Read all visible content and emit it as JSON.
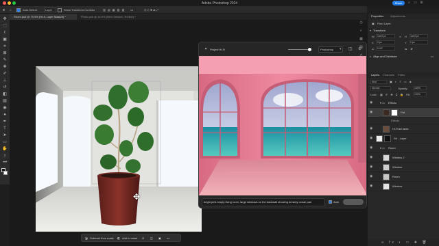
{
  "app": {
    "title": "Adobe Photoshop 2024",
    "share_label": "Share"
  },
  "options_bar": {
    "auto_select": "Auto-Select:",
    "layer_select": "Layer",
    "show_transform": "Show Transform Controls"
  },
  "tabs": [
    {
      "label": "Room.psd @ 70.9% (Ht-fl, Layer Mask/8) *",
      "active": true
    },
    {
      "label": "Photo.psd @ 16.6% (New Session, RGB/8) *",
      "active": false
    }
  ],
  "context_bar": {
    "subtract": "Subtract from mask",
    "add": "Add to mask"
  },
  "generate": {
    "title": "Project Hi-Fi",
    "mode": "Photoshop",
    "prompt": "bright pink empty living room, large windows on the backwall showing dreamy ocean pan",
    "auto_label": "Auto",
    "colors": {
      "wall": "#e7788f",
      "sea": "#3bb7b0",
      "sky": "#b9c4de",
      "floor": "#d9908f"
    }
  },
  "properties": {
    "tab_properties": "Properties",
    "tab_adjustments": "Adjustments",
    "pixel_layer": "Pixel Layer",
    "transform": "Transform",
    "w": "W",
    "h": "H",
    "x": "X",
    "y": "Y",
    "w_val": "1024 px",
    "h_val": "1024 px",
    "x_val": "0 px",
    "y_val": "0 px",
    "angle": "0.00°",
    "align": "Align and Distribute"
  },
  "layers": {
    "tab_layers": "Layers",
    "tab_channels": "Channels",
    "tab_paths": "Paths",
    "kind": "Kind",
    "blend_mode": "Normal",
    "opacity_label": "Opacity:",
    "opacity": "100%",
    "lock_label": "Lock:",
    "fill_label": "Fill:",
    "fill": "100%",
    "items": [
      {
        "name": "Effects",
        "type": "group"
      },
      {
        "name": "Pot",
        "type": "layer",
        "selected": true
      },
      {
        "name": "Effects",
        "type": "sub"
      },
      {
        "name": "Hi-Fidel table",
        "type": "layer"
      },
      {
        "name": "Srt - Layer",
        "type": "layer"
      },
      {
        "name": "Room",
        "type": "group"
      },
      {
        "name": "Window 2",
        "type": "layer"
      },
      {
        "name": "Window",
        "type": "layer"
      },
      {
        "name": "Room",
        "type": "layer"
      },
      {
        "name": "Window",
        "type": "layer"
      }
    ]
  }
}
